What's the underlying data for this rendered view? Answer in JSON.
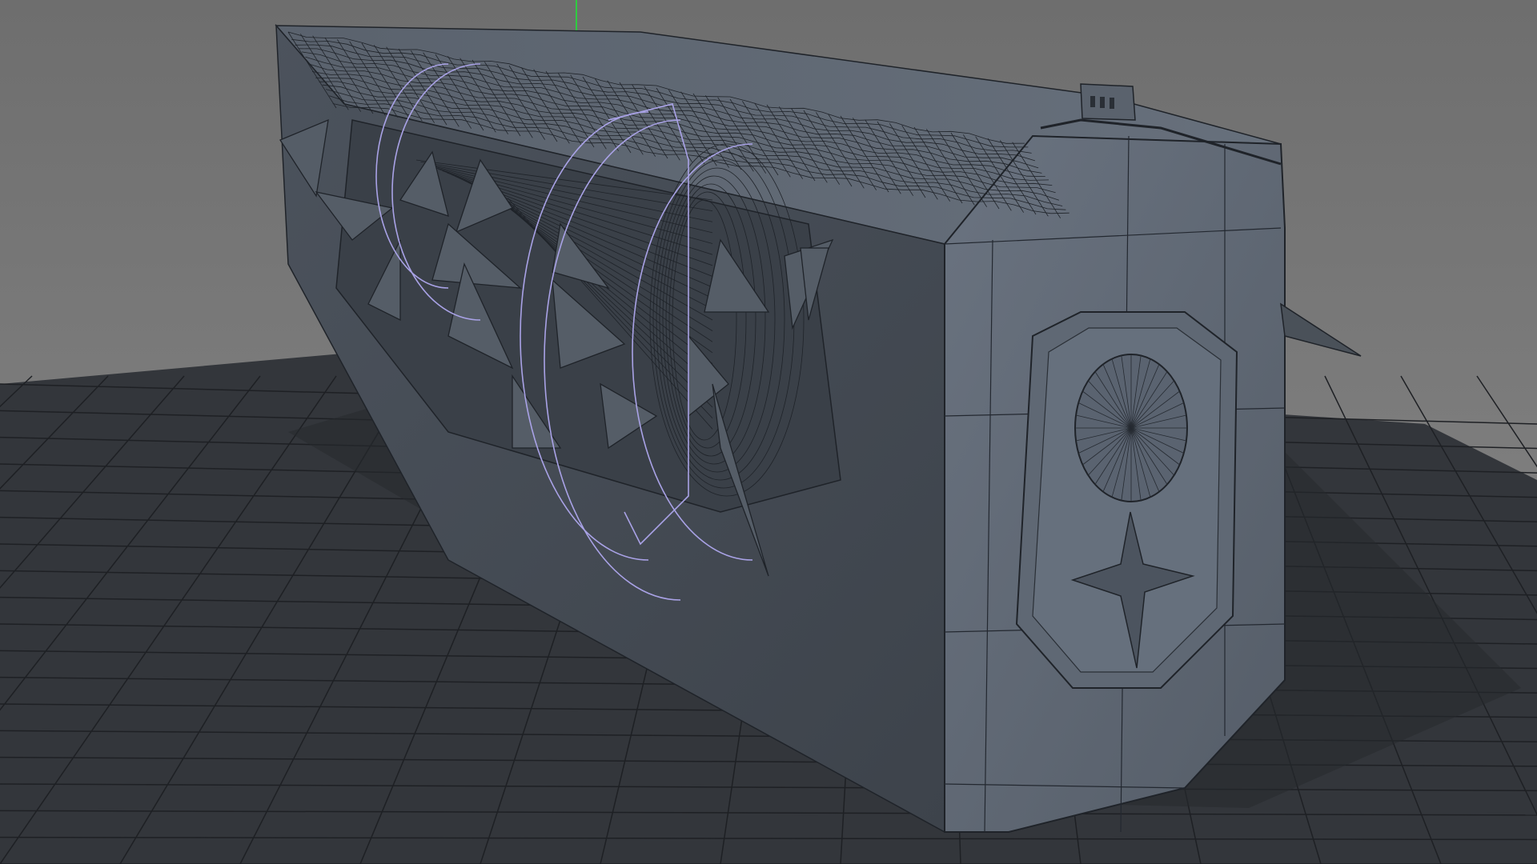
{
  "viewport": {
    "background_color": "#7a7a7a",
    "grid_plane_color": "#33363b",
    "grid_line_color": "#1e2024",
    "model_face_color": "#5b6470",
    "model_edge_color": "#1f2329",
    "selection_wire_color": "#a9a2e6",
    "axis_y_color": "#2ecc40"
  },
  "scene": {
    "object": "hexagonal-prism-vehicle",
    "has_selection_wire_arcs": true,
    "has_spike_shards": true,
    "has_ground_grid": true
  }
}
